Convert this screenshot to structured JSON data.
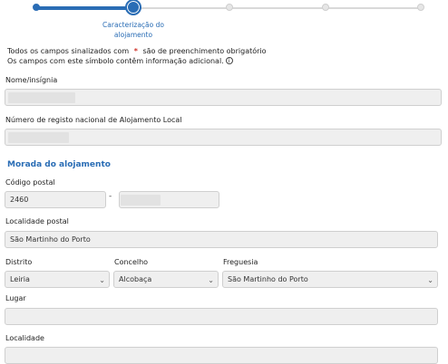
{
  "stepper": {
    "current_step_label": "Caracterização do alojamento"
  },
  "info": {
    "required_prefix": "Todos os campos sinalizados com",
    "required_star": "*",
    "required_suffix": "são de preenchimento obrigatório",
    "info_text": "Os campos com este símbolo contêm informação adicional.",
    "info_icon_glyph": "i"
  },
  "fields": {
    "nome_label": "Nome/insígnia",
    "nome_value": "",
    "registo_label": "Número de registo nacional de Alojamento Local",
    "registo_value": ""
  },
  "morada": {
    "section_title": "Morada do alojamento",
    "codigo_postal_label": "Código postal",
    "codigo_postal_1": "2460",
    "codigo_postal_sep": "-",
    "codigo_postal_2": "",
    "localidade_postal_label": "Localidade postal",
    "localidade_postal_value": "São Martinho do Porto",
    "distrito_label": "Distrito",
    "distrito_value": "Leiria",
    "concelho_label": "Concelho",
    "concelho_value": "Alcobaça",
    "freguesia_label": "Freguesia",
    "freguesia_value": "São Martinho do Porto",
    "lugar_label": "Lugar",
    "lugar_value": "",
    "localidade_label": "Localidade"
  },
  "icons": {
    "chevron": "⌄"
  }
}
